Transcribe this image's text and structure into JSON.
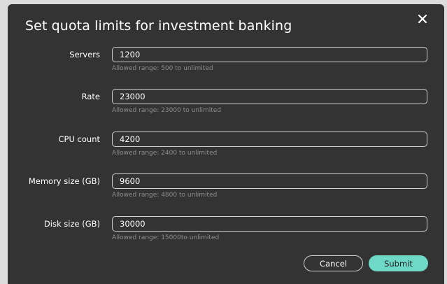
{
  "dialog": {
    "title": "Set quota limits for investment banking",
    "close_icon": "close-icon"
  },
  "fields": [
    {
      "label": "Servers",
      "value": "1200",
      "hint": "Allowed range: 500 to unlimited"
    },
    {
      "label": "Rate",
      "value": "23000",
      "hint": "Allowed range: 23000 to unlimited"
    },
    {
      "label": "CPU count",
      "value": "4200",
      "hint": "Allowed range: 2400 to unlimited"
    },
    {
      "label": "Memory size (GB)",
      "value": "9600",
      "hint": "Allowed range: 4800 to unlimited"
    },
    {
      "label": "Disk size (GB)",
      "value": "30000",
      "hint": "Allowed range: 15000to unlimited"
    }
  ],
  "actions": {
    "cancel_label": "Cancel",
    "submit_label": "Submit"
  },
  "colors": {
    "dialog_bg": "#333333",
    "backdrop": "#dcdcdc",
    "accent": "#6fd9c8",
    "hint_text": "#8c8c8c"
  }
}
